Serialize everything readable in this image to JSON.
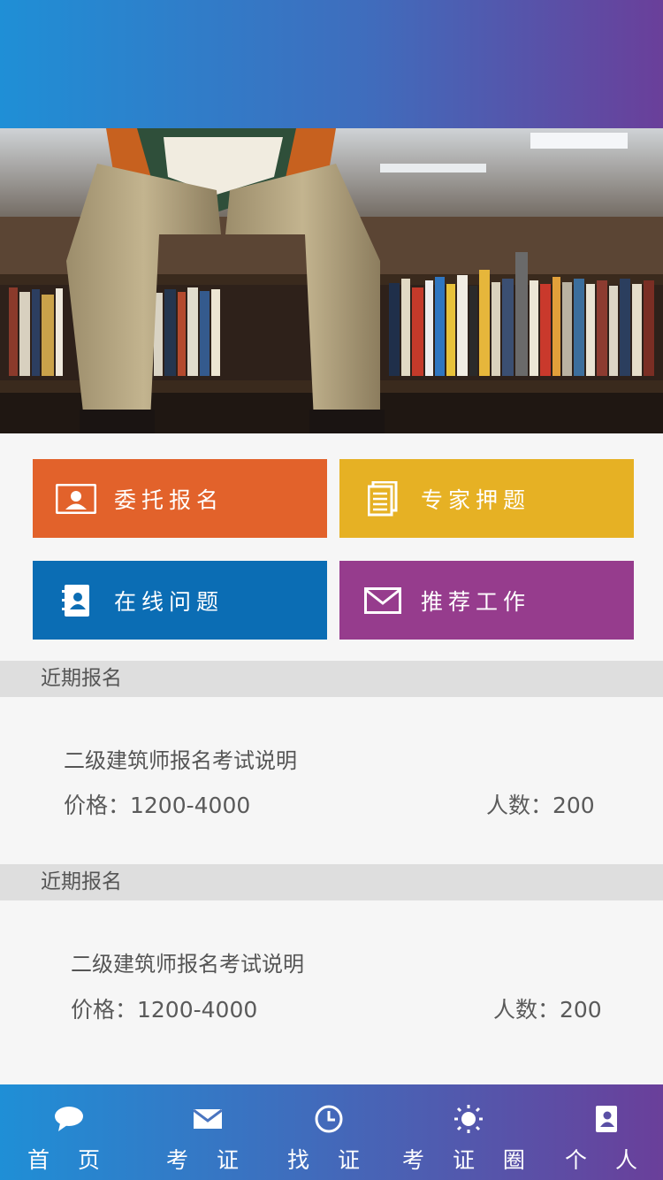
{
  "tiles": [
    {
      "label": "委托报名",
      "icon": "id-card-icon",
      "color": "#e2622b"
    },
    {
      "label": "专家押题",
      "icon": "document-icon",
      "color": "#e6b124"
    },
    {
      "label": "在线问题",
      "icon": "contact-book-icon",
      "color": "#0b6db4"
    },
    {
      "label": "推荐工作",
      "icon": "mail-icon",
      "color": "#963c8d"
    }
  ],
  "sections": [
    {
      "header": "近期报名",
      "title": "二级建筑师报名考试说明",
      "price": "价格：1200-4000",
      "people": "人数：200"
    },
    {
      "header": "近期报名",
      "title": "二级建筑师报名考试说明",
      "price": "价格：1200-4000",
      "people": "人数：200"
    }
  ],
  "tabbar": [
    {
      "label": "首 页",
      "icon": "chat-bubble-icon"
    },
    {
      "label": "考 证",
      "icon": "mail-icon"
    },
    {
      "label": "找 证",
      "icon": "clock-icon"
    },
    {
      "label": "考 证 圈",
      "icon": "sun-icon"
    },
    {
      "label": "个 人",
      "icon": "contact-book-icon"
    }
  ],
  "colors": {
    "header_gradient": [
      "#1f8fd6",
      "#6a3f9a"
    ],
    "section_header_bg": "#dedede",
    "page_bg": "#f6f6f6"
  }
}
